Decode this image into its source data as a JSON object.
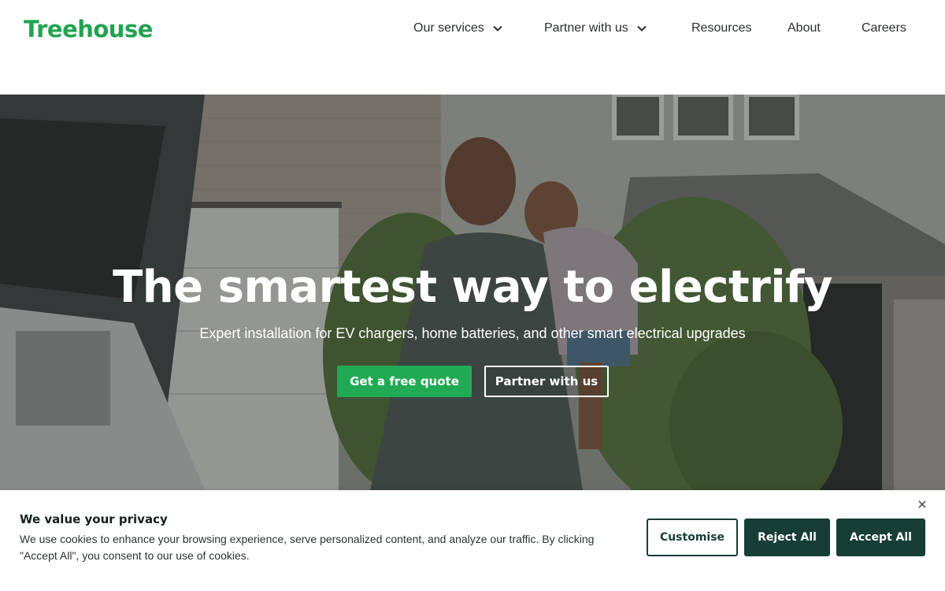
{
  "brand": {
    "logo_text": "Treehouse",
    "accent": "#21a34f"
  },
  "nav": {
    "items": [
      {
        "label": "Our services",
        "has_dropdown": true
      },
      {
        "label": "Partner with us",
        "has_dropdown": true
      },
      {
        "label": "Resources",
        "has_dropdown": false
      },
      {
        "label": "About",
        "has_dropdown": false
      },
      {
        "label": "Careers",
        "has_dropdown": false
      }
    ]
  },
  "hero": {
    "title": "The smartest way to electrify",
    "subtitle": "Expert installation for EV chargers, home batteries, and other smart electrical upgrades",
    "primary_button": "Get a free quote",
    "secondary_button": "Partner with us",
    "primary_color": "#22a954"
  },
  "cookie": {
    "title": "We value your privacy",
    "text": "We use cookies to enhance your browsing experience, serve personalized content, and analyze our traffic. By clicking \"Accept All\", you consent to our use of cookies.",
    "customise_label": "Customise",
    "reject_label": "Reject All",
    "accept_label": "Accept All",
    "button_color": "#173d37"
  },
  "icons": {
    "dropdown": "chevron-down-icon",
    "close": "close-icon"
  }
}
